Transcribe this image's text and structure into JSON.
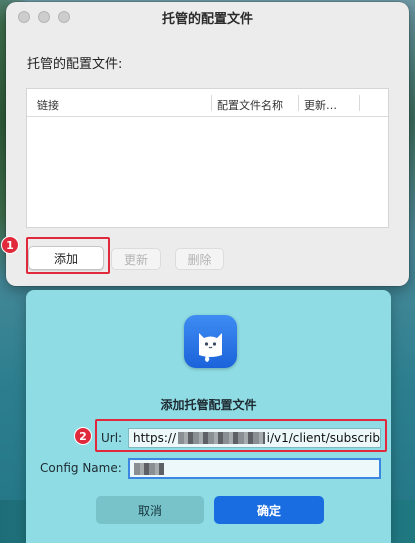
{
  "window": {
    "title": "托管的配置文件",
    "section_label": "托管的配置文件:",
    "table": {
      "columns": [
        "链接",
        "配置文件名称",
        "更新…"
      ],
      "rows": []
    },
    "buttons": {
      "add": "添加",
      "update": "更新",
      "delete": "删除"
    },
    "annotation_1": "1"
  },
  "dialog": {
    "title": "添加托管配置文件",
    "url_label": "Url:",
    "url_value_prefix": "https://",
    "url_value_suffix": "i/v1/client/subscrib",
    "config_name_label": "Config Name:",
    "cancel_label": "取消",
    "ok_label": "确定",
    "annotation_2": "2"
  },
  "colors": {
    "highlight": "#e02a3c",
    "primary_button": "#1a6de0",
    "dialog_background": "#8fdce4"
  },
  "icons": {
    "app": "cat-icon"
  }
}
